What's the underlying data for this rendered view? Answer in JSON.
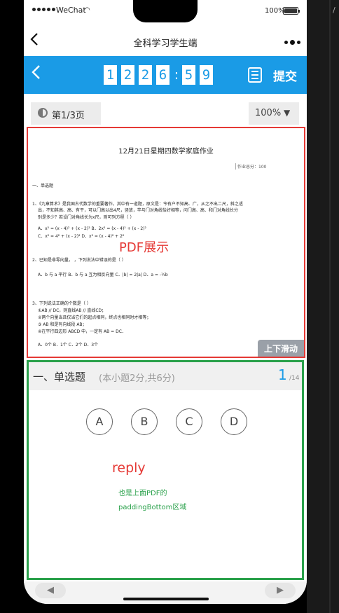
{
  "status": {
    "carrier": "WeChat",
    "battery": "100%",
    "battery_level": 1.0
  },
  "nav": {
    "title": "全科学习学生端"
  },
  "header": {
    "timer_digits": [
      "1",
      "2",
      "2",
      "6",
      "5",
      "9"
    ],
    "submit_label": "提交"
  },
  "toolbar": {
    "page_label": "第1/3页",
    "zoom": "100%",
    "zoom_caret": "▼"
  },
  "pdf": {
    "title": "12月21日星期四数学家庭作业",
    "score": "作业总分：100",
    "lines": [
      "一、单选题",
      "1、《九章算术》是我国古代数学的重要著作，其中有一道题，原文是：今有户不知高、广，从之不出二尺，斜之适",
      "出，不知其高、高、有干，可以门高以出4尺，竖放，竿与门对角线恰好相等，问门高、高、和门对角线长分",
      "别是多少？若设门对角线长为x尺，则可列方程（   ）",
      "A．x² = (x - 4)² + (x - 2)²                                        B．2x² = (x - 4)² + (x - 2)²",
      "C．x² = 4² + (x - 2)²                                                D．x² = (x - 4)² + 2²",
      "2、已知是非零向量，          ，下列说法中错误的是（   ）",
      "A．b 与 a 平行                          B．b 与 a 互为相反向量            C．|b| = 2|a|                    D．a = -½b",
      "3、下列说法正确的个数是（   ）",
      "①AB // DC，则直线AB // 直线CD；",
      "②两个向量当且仅当它们的起点相同，终点也相同时才相等；",
      "③ AB 和是有向线段 AB；",
      "④在平行四边形 ABCD 中，一定有 AB = DC．",
      "A．0个                                      B．1个                                  C．2个                              D．3个"
    ],
    "overlay_label": "PDF展示",
    "scroll_label": "上下滑动"
  },
  "question": {
    "section": "一、单选题",
    "sub": "(本小题2分,共6分)",
    "current": "1",
    "total": "/14",
    "options": [
      "A",
      "B",
      "C",
      "D"
    ]
  },
  "reply": {
    "label": "reply",
    "note": "也是上面PDF的paddingBottom区域"
  },
  "bottom": {
    "prev_icon": "◀",
    "next_icon": "▶"
  }
}
